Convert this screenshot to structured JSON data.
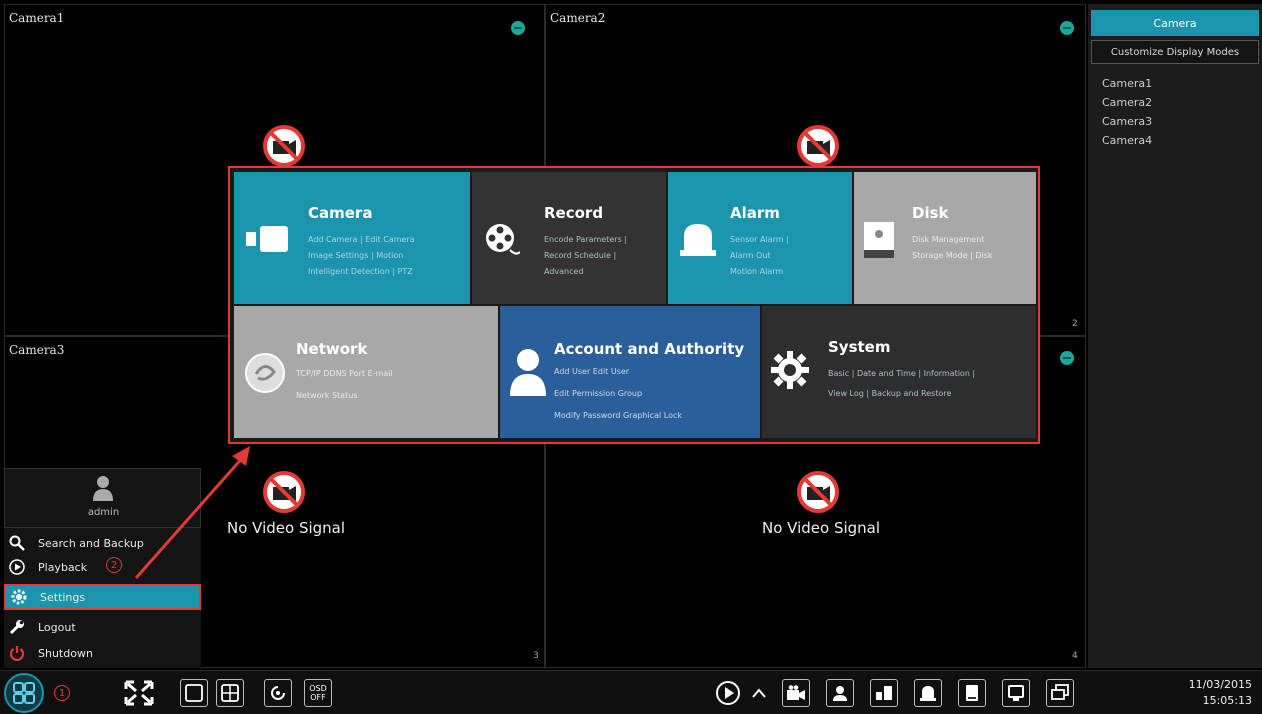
{
  "cameras": [
    {
      "name": "Camera1",
      "num": ""
    },
    {
      "name": "Camera2",
      "num": "2"
    },
    {
      "name": "Camera3",
      "num": "3"
    },
    {
      "name": "",
      "num": "4"
    }
  ],
  "no_video_text": "No Video Signal",
  "right_panel": {
    "header": "Camera",
    "customize_button": "Customize Display Modes",
    "items": [
      "Camera1",
      "Camera2",
      "Camera3",
      "Camera4"
    ]
  },
  "settings_menu": {
    "camera": {
      "title": "Camera",
      "line1": "Add Camera | Edit Camera",
      "line2": "Image Settings | Motion",
      "line3": "Intelligent Detection | PTZ"
    },
    "record": {
      "title": "Record",
      "line1": "Encode Parameters |",
      "line2": "Record Schedule |",
      "line3": "Advanced"
    },
    "alarm": {
      "title": "Alarm",
      "line1": "Sensor Alarm |",
      "line2": "Alarm Out",
      "line3": "Motion Alarm"
    },
    "disk": {
      "title": "Disk",
      "line1": "Disk Management",
      "line2": "Storage Mode | Disk"
    },
    "network": {
      "title": "Network",
      "line1": "TCP/IP  DDNS  Port  E-mail",
      "line2": "Network Status"
    },
    "account": {
      "title": "Account and Authority",
      "line1": "Add User  Edit User",
      "line2": "Edit Permission Group",
      "line3": "Modify Password  Graphical Lock"
    },
    "system": {
      "title": "System",
      "line1": "Basic | Date and Time | Information |",
      "line2": "View Log | Backup and Restore"
    }
  },
  "left_menu": {
    "user": "admin",
    "items": [
      "Search and Backup",
      "Playback",
      "Settings",
      "Logout",
      "Shutdown"
    ]
  },
  "bottom_bar": {
    "osd_line1": "OSD",
    "osd_line2": "OFF",
    "date": "11/03/2015",
    "time": "15:05:13"
  },
  "badges": {
    "one": "1",
    "two": "2"
  },
  "colors": {
    "accent": "#1a95ad",
    "highlight": "#e53935",
    "account_tile": "#2a5f9a"
  }
}
